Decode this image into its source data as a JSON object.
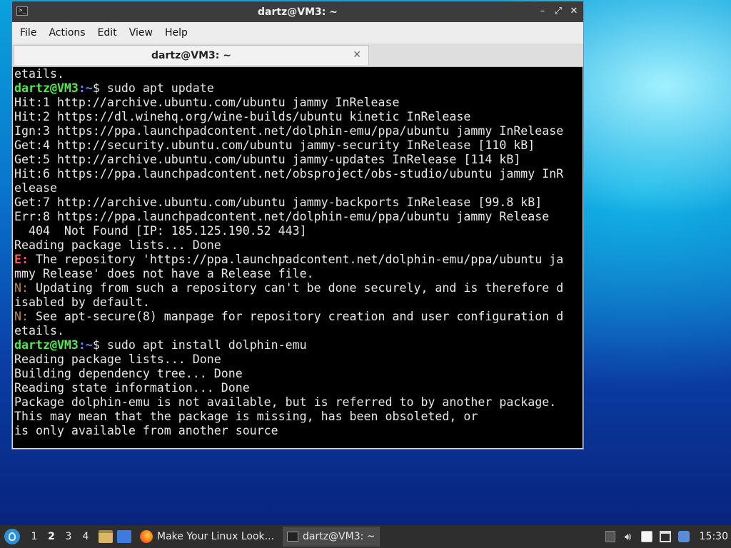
{
  "window": {
    "title": "dartz@VM3: ~",
    "controls": {
      "minimize": "–",
      "maximize": "⤢",
      "close": "✕"
    }
  },
  "menu": [
    "File",
    "Actions",
    "Edit",
    "View",
    "Help"
  ],
  "tab": {
    "label": "dartz@VM3: ~",
    "close": "✕"
  },
  "terminal": {
    "prompt_user": "dartz@VM3",
    "prompt_path": ":~",
    "lines": [
      {
        "text": "etails."
      },
      {
        "prompt": true,
        "cmd": "$ sudo apt update"
      },
      {
        "text": "Hit:1 http://archive.ubuntu.com/ubuntu jammy InRelease"
      },
      {
        "text": "Hit:2 https://dl.winehq.org/wine-builds/ubuntu kinetic InRelease"
      },
      {
        "text": "Ign:3 https://ppa.launchpadcontent.net/dolphin-emu/ppa/ubuntu jammy InRelease"
      },
      {
        "text": "Get:4 http://security.ubuntu.com/ubuntu jammy-security InRelease [110 kB]"
      },
      {
        "text": "Get:5 http://archive.ubuntu.com/ubuntu jammy-updates InRelease [114 kB]"
      },
      {
        "text": "Hit:6 https://ppa.launchpadcontent.net/obsproject/obs-studio/ubuntu jammy InR"
      },
      {
        "text": "elease"
      },
      {
        "text": "Get:7 http://archive.ubuntu.com/ubuntu jammy-backports InRelease [99.8 kB]"
      },
      {
        "text": "Err:8 https://ppa.launchpadcontent.net/dolphin-emu/ppa/ubuntu jammy Release"
      },
      {
        "text": "  404  Not Found [IP: 185.125.190.52 443]"
      },
      {
        "text": "Reading package lists... Done"
      },
      {
        "tag": "E:",
        "tagclass": "err",
        "text": " The repository 'https://ppa.launchpadcontent.net/dolphin-emu/ppa/ubuntu ja"
      },
      {
        "text": "mmy Release' does not have a Release file."
      },
      {
        "tag": "N:",
        "tagclass": "note",
        "text": " Updating from such a repository can't be done securely, and is therefore d"
      },
      {
        "text": "isabled by default."
      },
      {
        "tag": "N:",
        "tagclass": "note",
        "text": " See apt-secure(8) manpage for repository creation and user configuration d"
      },
      {
        "text": "etails."
      },
      {
        "prompt": true,
        "cmd": "$ sudo apt install dolphin-emu"
      },
      {
        "text": "Reading package lists... Done"
      },
      {
        "text": "Building dependency tree... Done"
      },
      {
        "text": "Reading state information... Done"
      },
      {
        "text": "Package dolphin-emu is not available, but is referred to by another package."
      },
      {
        "text": "This may mean that the package is missing, has been obsoleted, or"
      },
      {
        "text": "is only available from another source"
      }
    ]
  },
  "taskbar": {
    "workspaces": [
      "1",
      "2",
      "3",
      "4"
    ],
    "active_workspace": "2",
    "tasks": [
      {
        "label": "Make Your Linux Look...",
        "icon": "firefox-icon"
      },
      {
        "label": "dartz@VM3: ~",
        "icon": "terminal-icon"
      }
    ],
    "clock": "15:30"
  }
}
